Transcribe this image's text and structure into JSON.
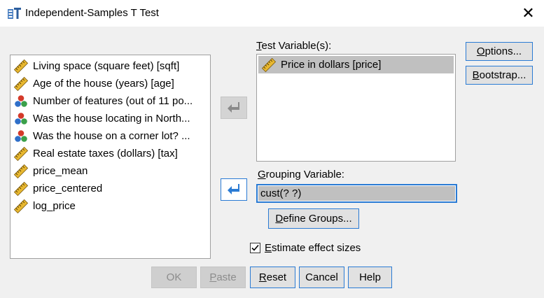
{
  "window": {
    "title": "Independent-Samples T Test",
    "close_glyph": "✕",
    "app_icon": "spss-ttest-icon"
  },
  "source_list": {
    "items": [
      {
        "label": "Living space (square feet) [sqft]",
        "icon": "scale-ruler-icon"
      },
      {
        "label": "Age of the house (years) [age]",
        "icon": "scale-ruler-icon"
      },
      {
        "label": "Number of features (out of 11 po...",
        "icon": "nominal-balls-icon"
      },
      {
        "label": "Was the house locating in North...",
        "icon": "nominal-balls-icon"
      },
      {
        "label": "Was the house on a corner lot? ...",
        "icon": "nominal-balls-icon"
      },
      {
        "label": "Real estate taxes (dollars) [tax]",
        "icon": "scale-ruler-icon"
      },
      {
        "label": "price_mean",
        "icon": "scale-ruler-icon"
      },
      {
        "label": "price_centered",
        "icon": "scale-ruler-icon"
      },
      {
        "label": "log_price",
        "icon": "scale-ruler-icon"
      }
    ]
  },
  "test_variables": {
    "label_mnemonic": "T",
    "label_rest": "est Variable(s):",
    "items": [
      {
        "label": "Price in dollars [price]",
        "icon": "scale-ruler-icon"
      }
    ]
  },
  "grouping": {
    "label_mnemonic": "G",
    "label_rest": "rouping Variable:",
    "value": "cust(? ?)"
  },
  "buttons": {
    "options": {
      "mnemonic": "O",
      "rest": "ptions..."
    },
    "bootstrap": {
      "mnemonic": "B",
      "rest": "ootstrap..."
    },
    "define_groups": {
      "mnemonic": "D",
      "rest": "efine Groups..."
    },
    "ok": "OK",
    "paste": {
      "mnemonic": "P",
      "rest": "aste"
    },
    "reset": {
      "mnemonic": "R",
      "rest": "eset"
    },
    "cancel": "Cancel",
    "help": "Help"
  },
  "effect_sizes": {
    "mnemonic": "E",
    "rest": "stimate effect sizes",
    "checked": true
  },
  "colors": {
    "accent": "#2a7bd4",
    "selection": "#c0c0c0",
    "dialog_bg": "#f0f0f0"
  }
}
